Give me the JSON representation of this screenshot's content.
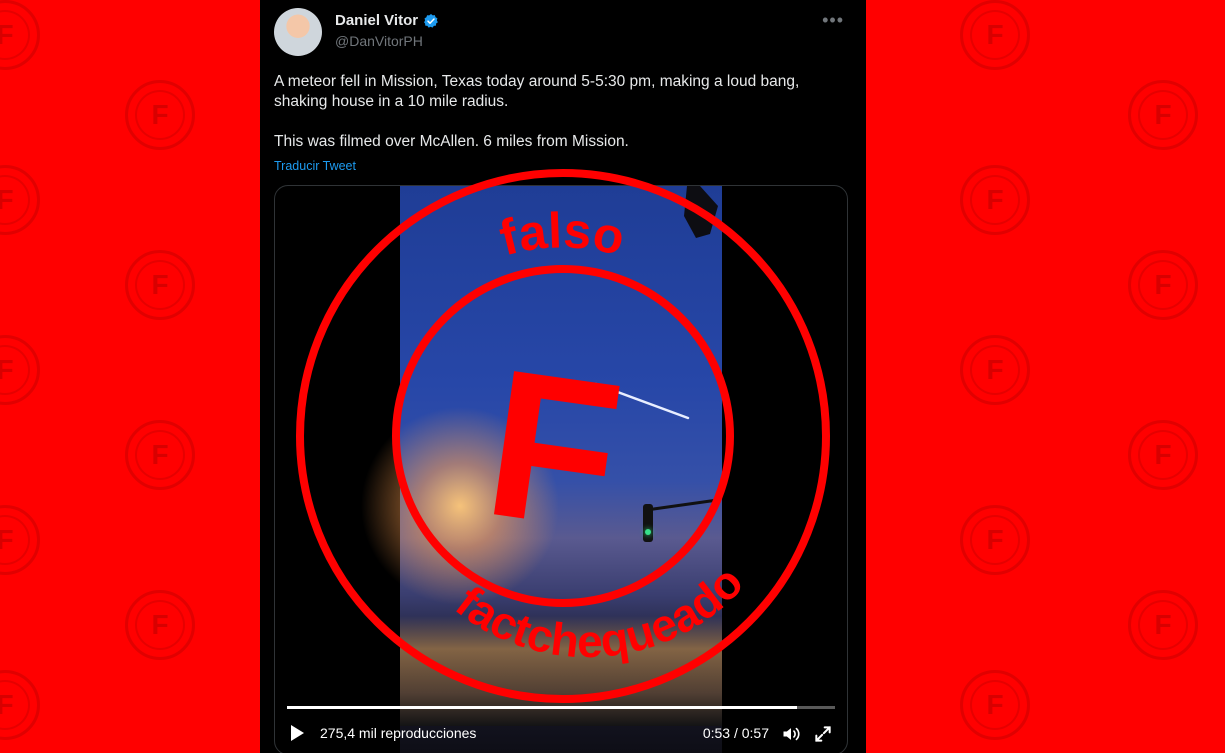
{
  "tweet": {
    "display_name": "Daniel Vitor",
    "handle": "@DanVitorPH",
    "text": "A meteor fell in Mission, Texas today around 5-5:30 pm, making a loud bang, shaking house in a 10 mile radius.\n\nThis was filmed over McAllen. 6 miles from Mission.",
    "translate_label": "Traducir Tweet",
    "more_icon": "more-dots-icon"
  },
  "video": {
    "views": "275,4 mil reproducciones",
    "time": "0:53 / 0:57",
    "progress": 0.93,
    "icons": [
      "play-icon",
      "volume-icon",
      "fullscreen-icon"
    ]
  },
  "stamp": {
    "top_word": "falso",
    "letter": "F",
    "bottom_word": "factchequeado",
    "color": "#ff0000"
  },
  "colors": {
    "background": "#ff0000",
    "card": "#000000",
    "link": "#1d9bf0",
    "verified": "#1d9bf0"
  }
}
